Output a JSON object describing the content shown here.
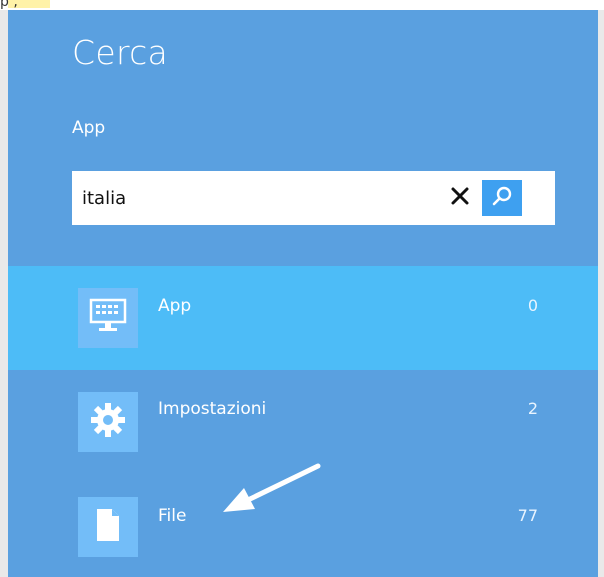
{
  "top_fragment": "p    ,",
  "charm": {
    "title": "Cerca",
    "scope": "App",
    "search": {
      "value": "italia",
      "clear_icon": "close-icon",
      "search_icon": "search-icon"
    },
    "results": [
      {
        "label": "App",
        "count": "0",
        "icon": "keyboard-monitor-icon",
        "selected": true
      },
      {
        "label": "Impostazioni",
        "count": "2",
        "icon": "gear-icon",
        "selected": false
      },
      {
        "label": "File",
        "count": "77",
        "icon": "document-icon",
        "selected": false
      }
    ]
  },
  "colors": {
    "panel": "#5aa0e0",
    "selected_row": "#4dbcf7",
    "icon_tile": "#73bdf8",
    "search_button": "#3ea0f0",
    "annotation_arrow": "#ffffff"
  }
}
